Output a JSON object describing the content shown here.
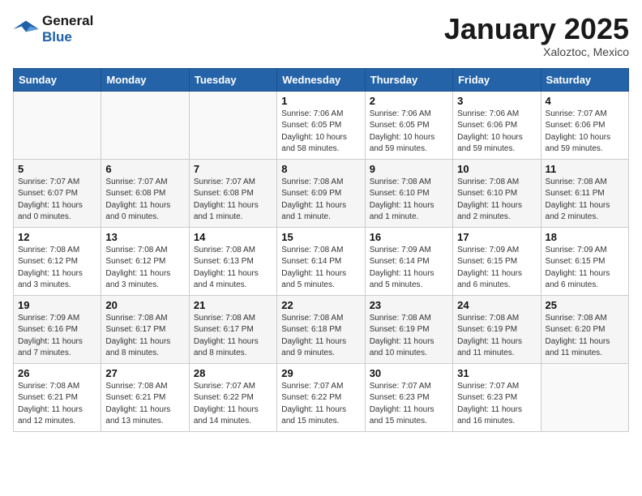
{
  "header": {
    "logo_line1": "General",
    "logo_line2": "Blue",
    "title": "January 2025",
    "subtitle": "Xaloztoc, Mexico"
  },
  "weekdays": [
    "Sunday",
    "Monday",
    "Tuesday",
    "Wednesday",
    "Thursday",
    "Friday",
    "Saturday"
  ],
  "weeks": [
    [
      {
        "day": "",
        "info": ""
      },
      {
        "day": "",
        "info": ""
      },
      {
        "day": "",
        "info": ""
      },
      {
        "day": "1",
        "info": "Sunrise: 7:06 AM\nSunset: 6:05 PM\nDaylight: 10 hours\nand 58 minutes."
      },
      {
        "day": "2",
        "info": "Sunrise: 7:06 AM\nSunset: 6:05 PM\nDaylight: 10 hours\nand 59 minutes."
      },
      {
        "day": "3",
        "info": "Sunrise: 7:06 AM\nSunset: 6:06 PM\nDaylight: 10 hours\nand 59 minutes."
      },
      {
        "day": "4",
        "info": "Sunrise: 7:07 AM\nSunset: 6:06 PM\nDaylight: 10 hours\nand 59 minutes."
      }
    ],
    [
      {
        "day": "5",
        "info": "Sunrise: 7:07 AM\nSunset: 6:07 PM\nDaylight: 11 hours\nand 0 minutes."
      },
      {
        "day": "6",
        "info": "Sunrise: 7:07 AM\nSunset: 6:08 PM\nDaylight: 11 hours\nand 0 minutes."
      },
      {
        "day": "7",
        "info": "Sunrise: 7:07 AM\nSunset: 6:08 PM\nDaylight: 11 hours\nand 1 minute."
      },
      {
        "day": "8",
        "info": "Sunrise: 7:08 AM\nSunset: 6:09 PM\nDaylight: 11 hours\nand 1 minute."
      },
      {
        "day": "9",
        "info": "Sunrise: 7:08 AM\nSunset: 6:10 PM\nDaylight: 11 hours\nand 1 minute."
      },
      {
        "day": "10",
        "info": "Sunrise: 7:08 AM\nSunset: 6:10 PM\nDaylight: 11 hours\nand 2 minutes."
      },
      {
        "day": "11",
        "info": "Sunrise: 7:08 AM\nSunset: 6:11 PM\nDaylight: 11 hours\nand 2 minutes."
      }
    ],
    [
      {
        "day": "12",
        "info": "Sunrise: 7:08 AM\nSunset: 6:12 PM\nDaylight: 11 hours\nand 3 minutes."
      },
      {
        "day": "13",
        "info": "Sunrise: 7:08 AM\nSunset: 6:12 PM\nDaylight: 11 hours\nand 3 minutes."
      },
      {
        "day": "14",
        "info": "Sunrise: 7:08 AM\nSunset: 6:13 PM\nDaylight: 11 hours\nand 4 minutes."
      },
      {
        "day": "15",
        "info": "Sunrise: 7:08 AM\nSunset: 6:14 PM\nDaylight: 11 hours\nand 5 minutes."
      },
      {
        "day": "16",
        "info": "Sunrise: 7:09 AM\nSunset: 6:14 PM\nDaylight: 11 hours\nand 5 minutes."
      },
      {
        "day": "17",
        "info": "Sunrise: 7:09 AM\nSunset: 6:15 PM\nDaylight: 11 hours\nand 6 minutes."
      },
      {
        "day": "18",
        "info": "Sunrise: 7:09 AM\nSunset: 6:15 PM\nDaylight: 11 hours\nand 6 minutes."
      }
    ],
    [
      {
        "day": "19",
        "info": "Sunrise: 7:09 AM\nSunset: 6:16 PM\nDaylight: 11 hours\nand 7 minutes."
      },
      {
        "day": "20",
        "info": "Sunrise: 7:08 AM\nSunset: 6:17 PM\nDaylight: 11 hours\nand 8 minutes."
      },
      {
        "day": "21",
        "info": "Sunrise: 7:08 AM\nSunset: 6:17 PM\nDaylight: 11 hours\nand 8 minutes."
      },
      {
        "day": "22",
        "info": "Sunrise: 7:08 AM\nSunset: 6:18 PM\nDaylight: 11 hours\nand 9 minutes."
      },
      {
        "day": "23",
        "info": "Sunrise: 7:08 AM\nSunset: 6:19 PM\nDaylight: 11 hours\nand 10 minutes."
      },
      {
        "day": "24",
        "info": "Sunrise: 7:08 AM\nSunset: 6:19 PM\nDaylight: 11 hours\nand 11 minutes."
      },
      {
        "day": "25",
        "info": "Sunrise: 7:08 AM\nSunset: 6:20 PM\nDaylight: 11 hours\nand 11 minutes."
      }
    ],
    [
      {
        "day": "26",
        "info": "Sunrise: 7:08 AM\nSunset: 6:21 PM\nDaylight: 11 hours\nand 12 minutes."
      },
      {
        "day": "27",
        "info": "Sunrise: 7:08 AM\nSunset: 6:21 PM\nDaylight: 11 hours\nand 13 minutes."
      },
      {
        "day": "28",
        "info": "Sunrise: 7:07 AM\nSunset: 6:22 PM\nDaylight: 11 hours\nand 14 minutes."
      },
      {
        "day": "29",
        "info": "Sunrise: 7:07 AM\nSunset: 6:22 PM\nDaylight: 11 hours\nand 15 minutes."
      },
      {
        "day": "30",
        "info": "Sunrise: 7:07 AM\nSunset: 6:23 PM\nDaylight: 11 hours\nand 15 minutes."
      },
      {
        "day": "31",
        "info": "Sunrise: 7:07 AM\nSunset: 6:23 PM\nDaylight: 11 hours\nand 16 minutes."
      },
      {
        "day": "",
        "info": ""
      }
    ]
  ]
}
